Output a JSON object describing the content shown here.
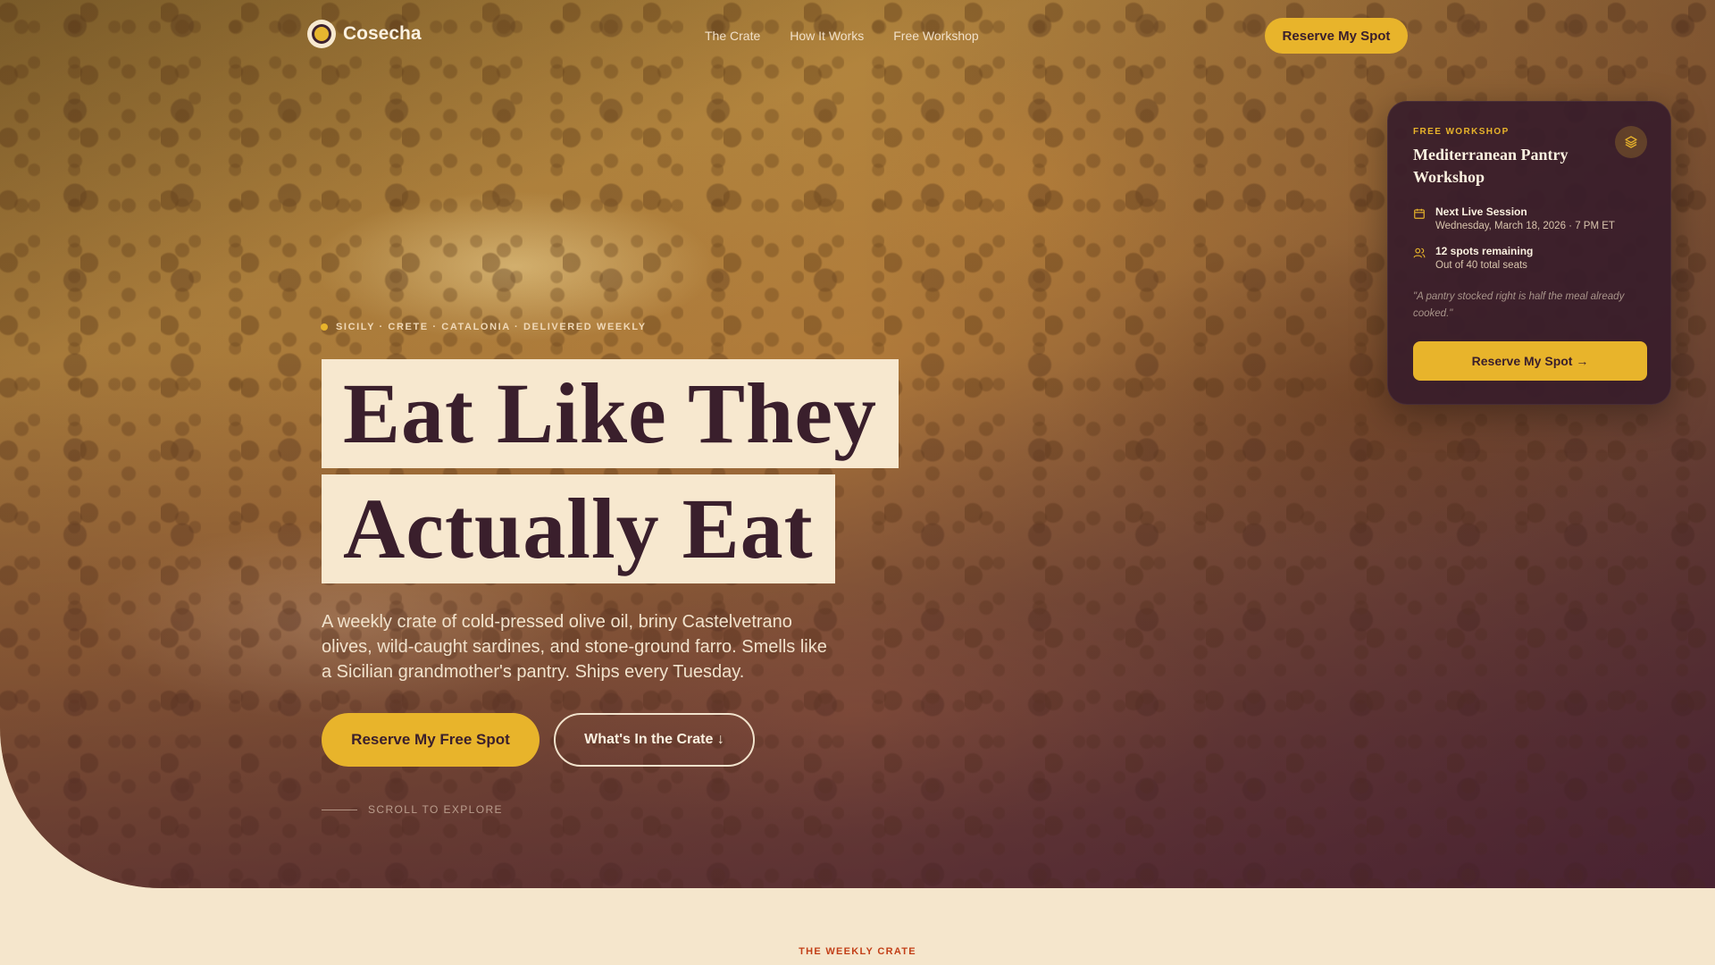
{
  "nav": {
    "brand": "Cosecha",
    "links": [
      "The Crate",
      "How It Works",
      "Free Workshop"
    ],
    "cta": "Reserve My Spot"
  },
  "hero": {
    "eyebrow": "SICILY · CRETE · CATALONIA · DELIVERED WEEKLY",
    "headline_line1": "Eat Like They",
    "headline_line2": "Actually Eat",
    "lede": "A weekly crate of cold-pressed olive oil, briny Castelvetrano olives, wild-caught sardines, and stone-ground farro. Smells like a Sicilian grandmother's pantry. Ships every Tuesday.",
    "primary_cta": "Reserve My Free Spot",
    "secondary_cta": "What's In the Crate ↓",
    "scroll_hint": "SCROLL TO EXPLORE"
  },
  "workshop_card": {
    "kicker": "FREE WORKSHOP",
    "title": "Mediterranean Pantry Workshop",
    "badge_icon": "layers-icon",
    "session_title": "Next Live Session",
    "session_date": "Wednesday, March 18, 2026 · 7 PM ET",
    "spots_title": "12 spots remaining",
    "spots_sub": "Out of 40 total seats",
    "quote": "\"A pantry stocked right is half the meal already cooked.\"",
    "cta": "Reserve My Spot →"
  },
  "next_section": {
    "kicker": "THE WEEKLY CRATE"
  },
  "colors": {
    "accent": "#e8b42b",
    "plum": "#3a1f2c",
    "cream": "#f5e6cc",
    "rust": "#c23f17"
  }
}
